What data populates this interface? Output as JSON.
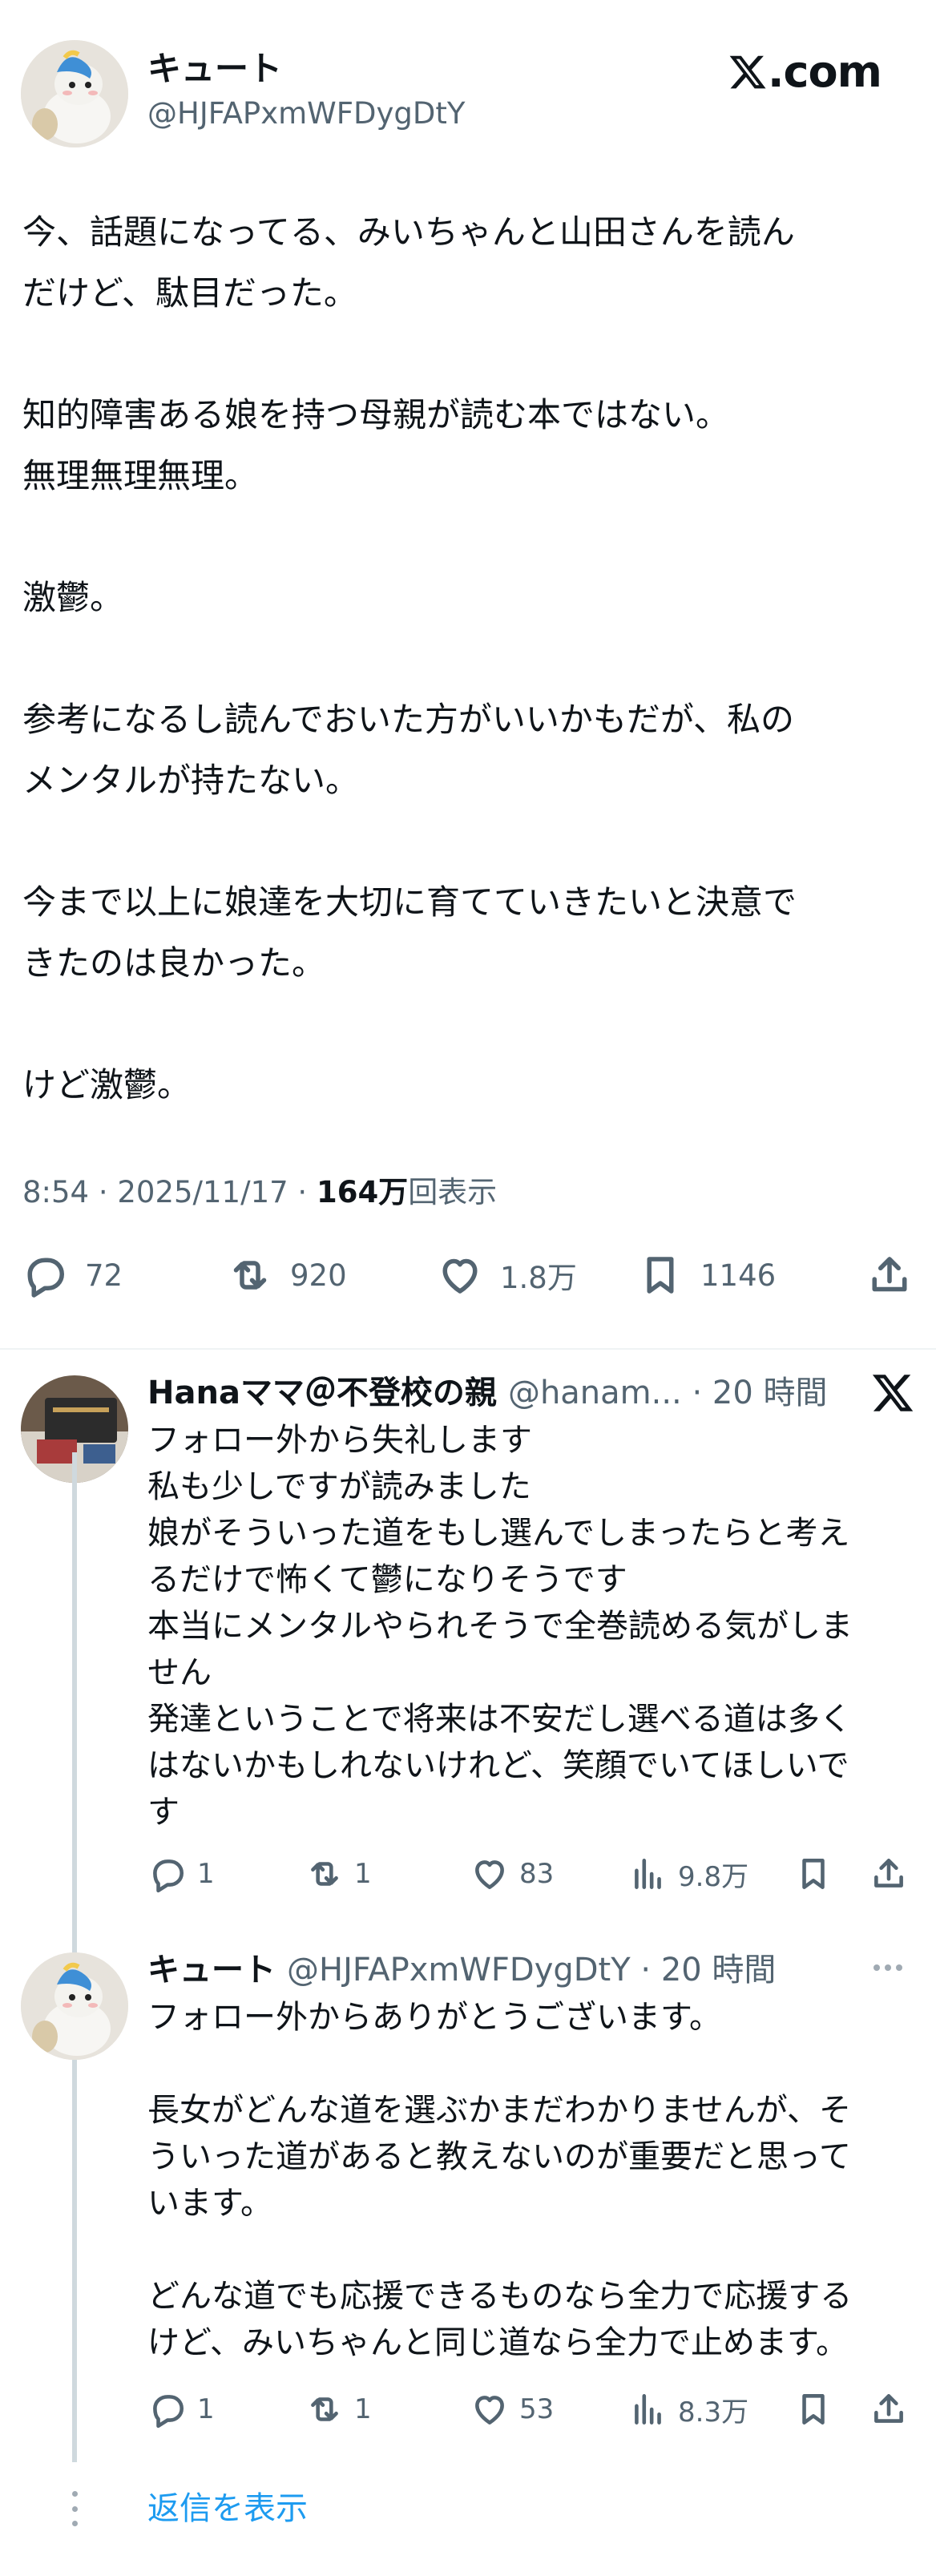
{
  "main_tweet": {
    "display_name": "キュート",
    "handle": "@HJFAPxmWFDygDtY",
    "brand": ".com",
    "paragraphs": [
      [
        "今、話題になってる、みいちゃんと山田さんを読ん",
        "だけど、駄目だった。"
      ],
      [
        "知的障害ある娘を持つ母親が読む本ではない。",
        "無理無理無理。"
      ],
      [
        "激鬱。"
      ],
      [
        "参考になるし読んでおいた方がいいかもだが、私の",
        "メンタルが持たない。"
      ],
      [
        "今まで以上に娘達を大切に育てていきたいと決意で",
        "きたのは良かった。"
      ],
      [
        "けど激鬱。"
      ]
    ],
    "meta": {
      "time": "8:54",
      "separator": " · ",
      "date": "2025/11/17",
      "views_count": "164万",
      "views_label": "回表示"
    },
    "actions": {
      "replies": "72",
      "reposts": "920",
      "likes": "1.8万",
      "bookmarks": "1146"
    }
  },
  "replies": [
    {
      "display_name": "Hanaママ＠不登校の親",
      "handle_time": "@hanam... · 20 時間",
      "lines": [
        "フォロー外から失礼します",
        "私も少しですが読みました",
        "娘がそういった道をもし選んでしまったらと考え",
        "るだけで怖くて鬱になりそうです",
        "本当にメンタルやられそうで全巻読める気がしま",
        "せん",
        "発達ということで将来は不安だし選べる道は多く",
        "はないかもしれないけれど、笑顔でいてほしいで",
        "す"
      ],
      "actions": {
        "replies": "1",
        "reposts": "1",
        "likes": "83",
        "views": "9.8万"
      }
    },
    {
      "display_name": "キュート",
      "handle_time": "@HJFAPxmWFDygDtY · 20 時間",
      "lines_a": [
        "フォロー外からありがとうございます。"
      ],
      "lines_b": [
        "長女がどんな道を選ぶかまだわかりませんが、そ",
        "ういった道があると教えないのが重要だと思って",
        "います。"
      ],
      "lines_c": [
        "どんな道でも応援できるものなら全力で応援する",
        "けど、みいちゃんと同じ道なら全力で止めます。"
      ],
      "actions": {
        "replies": "1",
        "reposts": "1",
        "likes": "53",
        "views": "8.3万"
      }
    }
  ],
  "show_replies_label": "返信を表示",
  "colors": {
    "link": "#1d9bf0",
    "secondary_text": "#536471",
    "thread_line": "#cfd9de"
  }
}
